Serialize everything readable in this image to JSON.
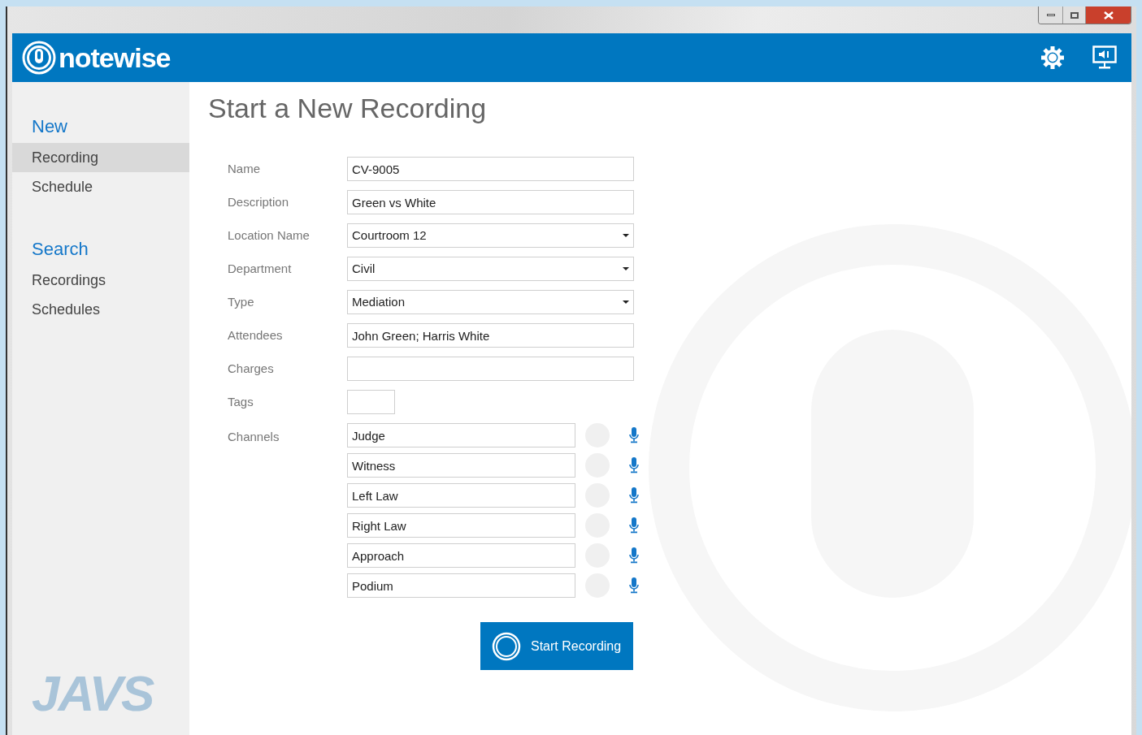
{
  "app": {
    "logo_text": "notewise"
  },
  "sidebar": {
    "sections": [
      {
        "heading": "New",
        "items": [
          {
            "label": "Recording",
            "selected": true
          },
          {
            "label": "Schedule",
            "selected": false
          }
        ]
      },
      {
        "heading": "Search",
        "items": [
          {
            "label": "Recordings",
            "selected": false
          },
          {
            "label": "Schedules",
            "selected": false
          }
        ]
      }
    ],
    "brand_mark": "JAVS"
  },
  "form": {
    "title": "Start a New Recording",
    "fields": [
      {
        "label": "Name",
        "kind": "text",
        "value": "CV-9005"
      },
      {
        "label": "Description",
        "kind": "text",
        "value": "Green vs White"
      },
      {
        "label": "Location Name",
        "kind": "dropdown",
        "value": "Courtroom 12"
      },
      {
        "label": "Department",
        "kind": "dropdown",
        "value": "Civil"
      },
      {
        "label": "Type",
        "kind": "dropdown",
        "value": "Mediation"
      },
      {
        "label": "Attendees",
        "kind": "text",
        "value": "John Green; Harris White"
      },
      {
        "label": "Charges",
        "kind": "text"
      },
      {
        "label": "Tags",
        "kind": "tags"
      }
    ],
    "channels_label": "Channels",
    "channels": [
      {
        "value": "Judge"
      },
      {
        "value": "Witness"
      },
      {
        "value": "Left Law"
      },
      {
        "value": "Right Law"
      },
      {
        "value": "Approach"
      },
      {
        "value": "Podium"
      }
    ],
    "submit": "Start Recording"
  }
}
